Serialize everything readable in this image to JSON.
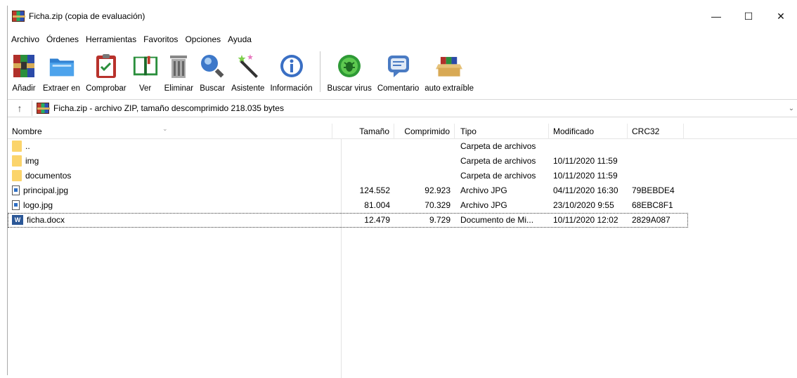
{
  "window": {
    "title": "Ficha.zip (copia de evaluación)",
    "controls": {
      "minimize": "—",
      "maximize": "☐",
      "close": "✕"
    }
  },
  "menu": [
    "Archivo",
    "Órdenes",
    "Herramientas",
    "Favoritos",
    "Opciones",
    "Ayuda"
  ],
  "toolbar": {
    "group1": [
      {
        "label": "Añadir",
        "icon": "rar-archive-icon"
      },
      {
        "label": "Extraer en",
        "icon": "extract-folder-icon"
      },
      {
        "label": "Comprobar",
        "icon": "clipboard-check-icon"
      },
      {
        "label": "Ver",
        "icon": "book-icon"
      },
      {
        "label": "Eliminar",
        "icon": "trash-icon"
      },
      {
        "label": "Buscar",
        "icon": "magnifier-icon"
      },
      {
        "label": "Asistente",
        "icon": "wand-icon"
      },
      {
        "label": "Información",
        "icon": "info-icon"
      }
    ],
    "group2": [
      {
        "label": "Buscar virus",
        "icon": "virus-scan-icon"
      },
      {
        "label": "Comentario",
        "icon": "comment-icon"
      },
      {
        "label": "auto extraíble",
        "icon": "sfx-box-icon"
      }
    ]
  },
  "address": {
    "up": "↑",
    "text": "Ficha.zip - archivo ZIP, tamaño descomprimido 218.035 bytes",
    "dropdown": "⌄"
  },
  "columns": {
    "name": "Nombre",
    "size": "Tamaño",
    "compressed": "Comprimido",
    "type": "Tipo",
    "modified": "Modificado",
    "crc": "CRC32",
    "sort": "⌄"
  },
  "files": [
    {
      "icon": "folder-icon",
      "name": "..",
      "size": "",
      "compressed": "",
      "type": "Carpeta de archivos",
      "modified": "",
      "crc": ""
    },
    {
      "icon": "folder-icon",
      "name": "img",
      "size": "",
      "compressed": "",
      "type": "Carpeta de archivos",
      "modified": "10/11/2020 11:59",
      "crc": ""
    },
    {
      "icon": "folder-icon",
      "name": "documentos",
      "size": "",
      "compressed": "",
      "type": "Carpeta de archivos",
      "modified": "10/11/2020 11:59",
      "crc": ""
    },
    {
      "icon": "jpg-file-icon",
      "name": "principal.jpg",
      "size": "124.552",
      "compressed": "92.923",
      "type": "Archivo JPG",
      "modified": "04/11/2020 16:30",
      "crc": "79BEBDE4"
    },
    {
      "icon": "jpg-file-icon",
      "name": "logo.jpg",
      "size": "81.004",
      "compressed": "70.329",
      "type": "Archivo JPG",
      "modified": "23/10/2020 9:55",
      "crc": "68EBC8F1"
    },
    {
      "icon": "word-file-icon",
      "name": "ficha.docx",
      "size": "12.479",
      "compressed": "9.729",
      "type": "Documento de Mi...",
      "modified": "10/11/2020 12:02",
      "crc": "2829A087"
    }
  ]
}
